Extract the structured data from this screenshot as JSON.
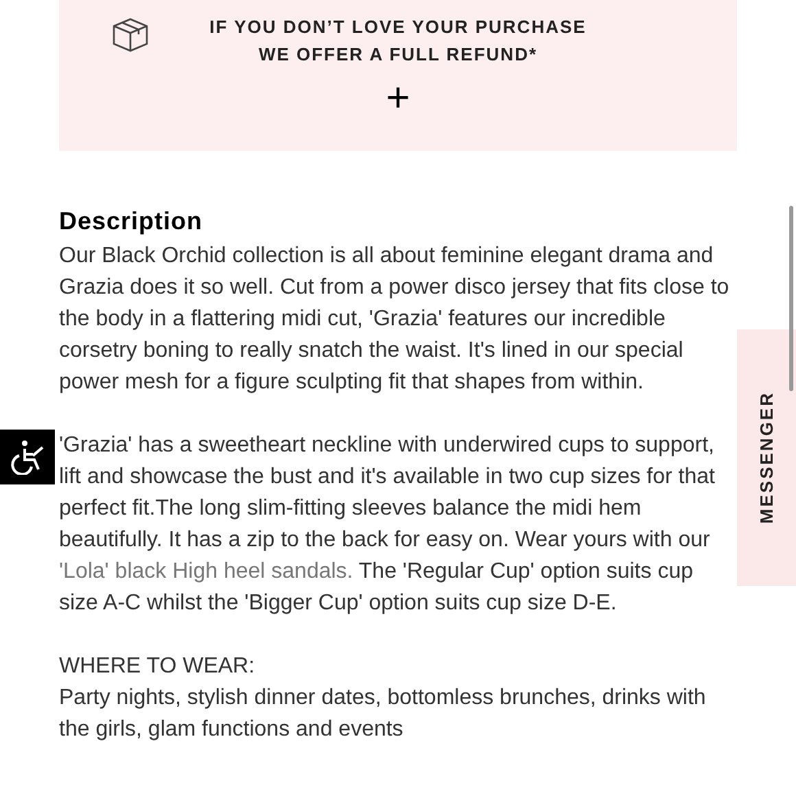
{
  "refund_banner": {
    "lines": [
      "IF YOU DON’T LOVE YOUR PURCHASE",
      "WE OFFER A FULL REFUND*"
    ],
    "expand_symbol": "+"
  },
  "description": {
    "heading": "Description",
    "paragraph_1": "Our Black Orchid collection is all about feminine elegant drama and Grazia does it so well. Cut from a power disco jersey that fits close to the body in a flattering midi cut, 'Grazia' features our incredible corsetry boning to really snatch the waist. It's lined in our special power mesh for a figure sculpting fit that shapes from within.",
    "paragraph_2": {
      "before": "'Grazia' has a sweetheart neckline with underwired cups to support, lift and showcase the bust and it's available in two cup sizes for that perfect fit.The long slim-fitting sleeves balance the midi hem beautifully. It has a zip to the back for easy on. Wear yours with our ",
      "link": "'Lola' black High heel sandals.",
      "after": " The 'Regular Cup' option suits cup size A-C whilst the 'Bigger Cup' option suits cup size D-E."
    },
    "where_to_wear": {
      "heading": "WHERE TO WEAR:",
      "text": "Party nights, stylish dinner dates, bottomless brunches, drinks with the girls, glam functions and events"
    }
  },
  "messenger_tab": {
    "label": "MESSENGER"
  }
}
